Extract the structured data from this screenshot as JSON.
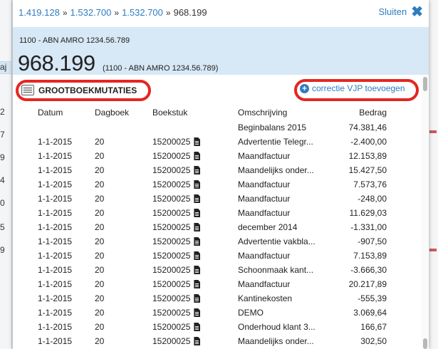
{
  "background": {
    "left_fragments": [
      "aj",
      "2",
      "7",
      "9",
      "4",
      "0",
      "5",
      "9"
    ]
  },
  "breadcrumb": {
    "items": [
      "1.419.128",
      "1.532.700",
      "1.532.700"
    ],
    "current": "968.199"
  },
  "close_label": "Sluiten",
  "header": {
    "account": "1100 - ABN AMRO 1234.56.789",
    "amount": "968.199",
    "amount_sub": "(1100 - ABN AMRO 1234.56.789)"
  },
  "ledger": {
    "title": "GROOTBOEKMUTATIES",
    "correction_label": "correctie VJP toevoegen"
  },
  "table": {
    "columns": [
      "Datum",
      "Dagboek",
      "Boekstuk",
      "Omschrijving",
      "Bedrag"
    ],
    "opening": {
      "description": "Beginbalans 2015",
      "amount": "74.381,46"
    },
    "rows": [
      {
        "date": "1-1-2015",
        "book": "20",
        "doc": "15200025",
        "desc": "Advertentie Telegr...",
        "amount": "-2.400,00"
      },
      {
        "date": "1-1-2015",
        "book": "20",
        "doc": "15200025",
        "desc": "Maandfactuur",
        "amount": "12.153,89"
      },
      {
        "date": "1-1-2015",
        "book": "20",
        "doc": "15200025",
        "desc": "Maandelijks onder...",
        "amount": "15.427,50"
      },
      {
        "date": "1-1-2015",
        "book": "20",
        "doc": "15200025",
        "desc": "Maandfactuur",
        "amount": "7.573,76"
      },
      {
        "date": "1-1-2015",
        "book": "20",
        "doc": "15200025",
        "desc": "Maandfactuur",
        "amount": "-248,00"
      },
      {
        "date": "1-1-2015",
        "book": "20",
        "doc": "15200025",
        "desc": "Maandfactuur",
        "amount": "11.629,03"
      },
      {
        "date": "1-1-2015",
        "book": "20",
        "doc": "15200025",
        "desc": "december 2014",
        "amount": "-1.331,00"
      },
      {
        "date": "1-1-2015",
        "book": "20",
        "doc": "15200025",
        "desc": "Advertentie vakbla...",
        "amount": "-907,50"
      },
      {
        "date": "1-1-2015",
        "book": "20",
        "doc": "15200025",
        "desc": "Maandfactuur",
        "amount": "7.153,89"
      },
      {
        "date": "1-1-2015",
        "book": "20",
        "doc": "15200025",
        "desc": "Schoonmaak kant...",
        "amount": "-3.666,30"
      },
      {
        "date": "1-1-2015",
        "book": "20",
        "doc": "15200025",
        "desc": "Maandfactuur",
        "amount": "20.217,89"
      },
      {
        "date": "1-1-2015",
        "book": "20",
        "doc": "15200025",
        "desc": "Kantinekosten",
        "amount": "-555,39"
      },
      {
        "date": "1-1-2015",
        "book": "20",
        "doc": "15200025",
        "desc": "DEMO",
        "amount": "3.069,64"
      },
      {
        "date": "1-1-2015",
        "book": "20",
        "doc": "15200025",
        "desc": "Onderhoud klant 3...",
        "amount": "166,67"
      },
      {
        "date": "1-1-2015",
        "book": "20",
        "doc": "15200025",
        "desc": "Maandelijks onder...",
        "amount": "302,50"
      }
    ]
  },
  "colors": {
    "link": "#2f7cbf",
    "header_bg": "#d7e8f6",
    "highlight": "#e52620"
  }
}
